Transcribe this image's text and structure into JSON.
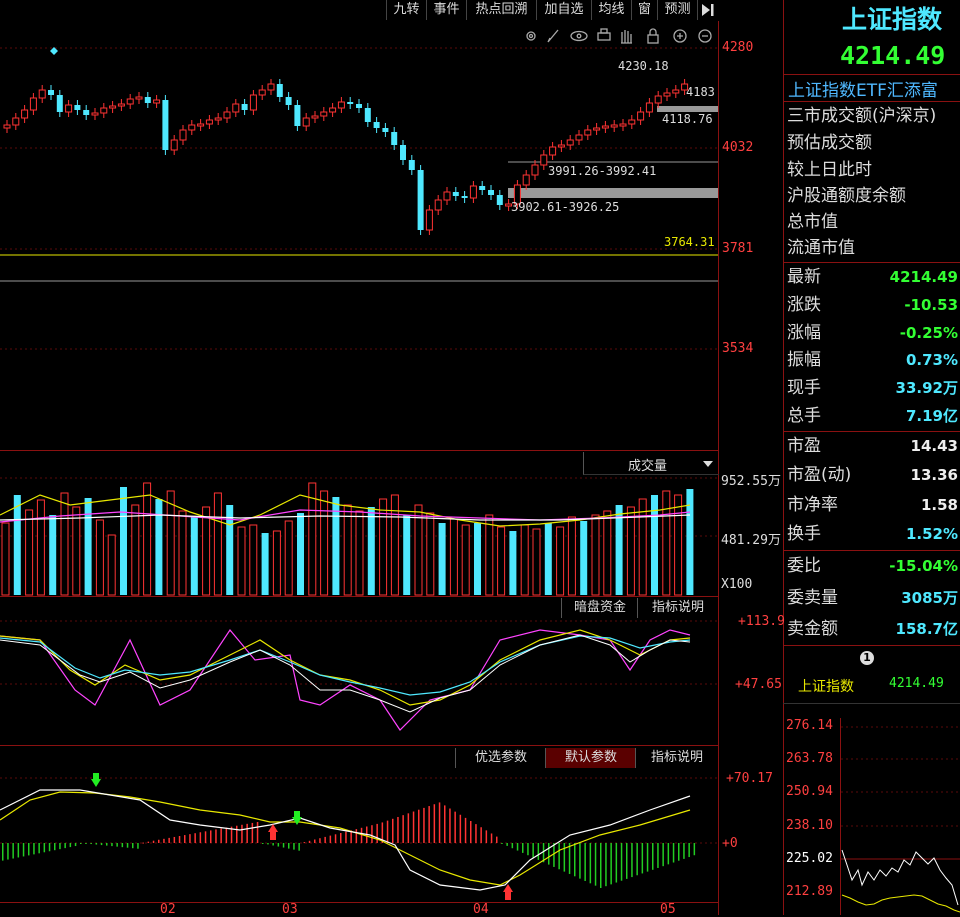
{
  "toolbar": {
    "buttons": [
      "九转",
      "事件",
      "热点回溯",
      "加自选",
      "均线",
      "窗",
      "预测"
    ],
    "icons": [
      "gear-icon",
      "pen-icon",
      "eye-icon",
      "print-icon",
      "hand-icon",
      "lock-icon",
      "zoom-in-icon",
      "zoom-out-icon"
    ]
  },
  "price_axis": {
    "labels": [
      "4280",
      "4032",
      "3781",
      "3534"
    ]
  },
  "annotations": {
    "high": "4230.18",
    "p1": "4183",
    "p2": "4118.76",
    "gap1": "3991.26-3992.41",
    "gap2": "3902.61-3926.25",
    "low_line": "3764.31"
  },
  "volume_panel": {
    "title": "成交量",
    "labels": [
      "952.55万",
      "481.29万",
      "X100"
    ]
  },
  "dark_pool": {
    "tabs": [
      "暗盘资金",
      "指标说明"
    ],
    "labels": [
      "+113.9",
      "+47.65"
    ]
  },
  "macd": {
    "tabs": [
      "优选参数",
      "默认参数",
      "指标说明"
    ],
    "labels": [
      "+70.17",
      "+0"
    ]
  },
  "x_axis": {
    "labels": [
      "02",
      "03",
      "04",
      "05"
    ]
  },
  "quote": {
    "name": "上证指数",
    "price": "4214.49",
    "etf_link": "上证指数ETF汇添富",
    "info_rows": [
      "三市成交额(沪深京)",
      "预估成交额",
      "较上日此时",
      "沪股通额度余额",
      "总市值",
      "流通市值"
    ],
    "stats1": [
      {
        "label": "最新",
        "value": "4214.49",
        "color": "green"
      },
      {
        "label": "涨跌",
        "value": "-10.53",
        "color": "green"
      },
      {
        "label": "涨幅",
        "value": "-0.25%",
        "color": "green"
      },
      {
        "label": "振幅",
        "value": "0.73%",
        "color": "cyan"
      },
      {
        "label": "现手",
        "value": "33.92万",
        "color": "cyan"
      },
      {
        "label": "总手",
        "value": "7.19亿",
        "color": "cyan"
      }
    ],
    "stats2": [
      {
        "label": "市盈",
        "value": "14.43",
        "color": "white"
      },
      {
        "label": "市盈(动)",
        "value": "13.36",
        "color": "white"
      },
      {
        "label": "市净率",
        "value": "1.58",
        "color": "white"
      },
      {
        "label": "换手",
        "value": "1.52%",
        "color": "cyan"
      }
    ],
    "stats3": [
      {
        "label": "委比",
        "value": "-15.04%",
        "color": "green"
      },
      {
        "label": "委卖量",
        "value": "3085万",
        "color": "cyan"
      },
      {
        "label": "卖金额",
        "value": "158.7亿",
        "color": "cyan"
      }
    ]
  },
  "mini_chart": {
    "circle_number": "1",
    "name": "上证指数",
    "price": "4214.49",
    "labels": [
      "276.14",
      "263.78",
      "250.94",
      "238.10",
      "225.02",
      "212.89"
    ]
  },
  "colors": {
    "up": "#ff3333",
    "down": "#4fe8ff",
    "axis": "#8a1111",
    "ma_yellow": "#e8e800",
    "ma_white": "#ffffff",
    "ma_magenta": "#ff44ff"
  }
}
